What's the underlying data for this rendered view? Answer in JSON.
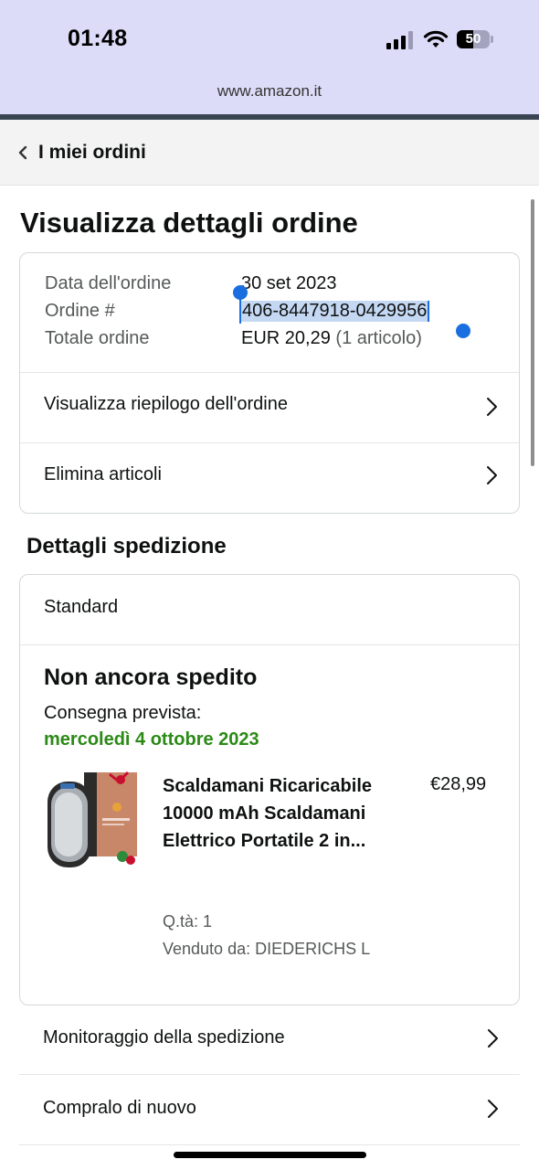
{
  "status_bar": {
    "time": "01:48",
    "battery_level": "50",
    "battery_percent": 50,
    "signal_icon": "cellular-signal-icon",
    "wifi_icon": "wifi-icon"
  },
  "browser": {
    "url": "www.amazon.it"
  },
  "header": {
    "back_label": "I miei ordini",
    "back_icon": "chevron-left-icon"
  },
  "page": {
    "title": "Visualizza dettagli ordine"
  },
  "order_summary": {
    "date_label": "Data dell'ordine",
    "date_value": "30 set 2023",
    "order_label": "Ordine #",
    "order_value": "406-8447918-0429956",
    "total_label": "Totale ordine",
    "total_value": "EUR 20,29",
    "total_items": "(1 articolo)",
    "links": [
      {
        "label": "Visualizza riepilogo dell'ordine",
        "icon": "chevron-right-icon"
      },
      {
        "label": "Elimina articoli",
        "icon": "chevron-right-icon"
      }
    ]
  },
  "shipping": {
    "section_title": "Dettagli spedizione",
    "method": "Standard",
    "status": "Non ancora spedito",
    "delivery_label": "Consegna prevista:",
    "delivery_date": "mercoledì 4 ottobre 2023",
    "delivery_color": "#2b8a16",
    "product": {
      "image_icon": "hand-warmer-product-image",
      "name": "Scaldamani Ricaricabile 10000 mAh Scaldamani Elettrico Portatile 2 in...",
      "price": "€28,99",
      "quantity": "Q.tà: 1",
      "seller": "Venduto da: DIEDERICHS L"
    }
  },
  "actions": [
    {
      "label": "Monitoraggio della spedizione",
      "icon": "chevron-right-icon"
    },
    {
      "label": "Compralo di nuovo",
      "icon": "chevron-right-icon"
    }
  ],
  "colors": {
    "selection": "#1a6ee0",
    "selection_fill": "#c5d8f3",
    "status_bar_bg": "#dcdcf8"
  }
}
